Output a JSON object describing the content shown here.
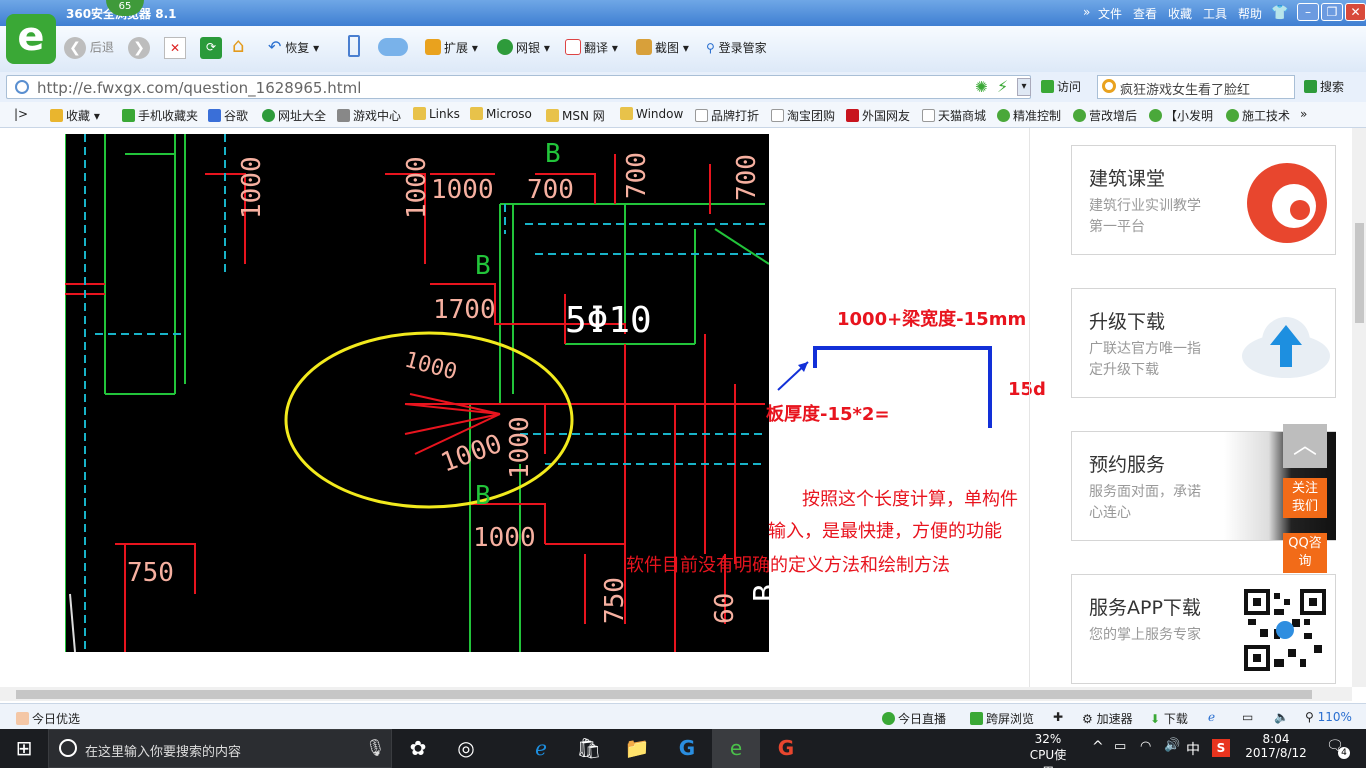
{
  "window": {
    "title": "360安全浏览器 8.1",
    "badge": "65",
    "menu": [
      "文件",
      "查看",
      "收藏",
      "工具",
      "帮助"
    ],
    "min": "–",
    "max": "❐",
    "close": "✕"
  },
  "toolbar": {
    "back": "后退",
    "restore": "恢复",
    "extend": "扩展",
    "netbank": "网银",
    "translate": "翻译",
    "screenshot": "截图",
    "login": "登录管家"
  },
  "address": {
    "url": "http://e.fwxgx.com/question_1628965.html",
    "visit": "访问",
    "search_value": "疯狂游戏女生看了脸红",
    "search_button": "搜索"
  },
  "bookmarks": [
    "收藏",
    "手机收藏夹",
    "谷歌",
    "网址大全",
    "游戏中心",
    "Links",
    "Microso",
    "MSN 网",
    "Window",
    "品牌打折",
    "淘宝团购",
    "外国网友",
    "天猫商城",
    "精准控制",
    "营改增后",
    "【小发明",
    "施工技术"
  ],
  "cad": {
    "labels": [
      "1000",
      "1000",
      "700",
      "700",
      "700",
      "1000",
      "1700",
      "5Φ10",
      "1000",
      "1000",
      "1000",
      "1000",
      "750",
      "750",
      "60",
      "B",
      "B",
      "B",
      "B"
    ]
  },
  "annotation": {
    "top_label": "1000+梁宽度-15mm",
    "side_label": "15d",
    "left_label": "板厚度-15*2=",
    "note_line1": "按照这个长度计算，单构件",
    "note_line2": "输入，是最快捷，方便的功能",
    "note_line3": "软件目前没有明确的定义方法和绘制方法"
  },
  "sidebar": {
    "cards": [
      {
        "title": "建筑课堂",
        "sub": "建筑行业实训教学第一平台"
      },
      {
        "title": "升级下载",
        "sub": "广联达官方唯一指定升级下载"
      },
      {
        "title": "预约服务",
        "sub": "服务面对面，承诺心连心"
      },
      {
        "title": "服务APP下载",
        "sub": "您的掌上服务专家"
      }
    ],
    "follow": "关注我们",
    "qq": "QQ咨询"
  },
  "status": {
    "left": "今日优选",
    "live": "今日直播",
    "cross": "跨屏浏览",
    "accel": "加速器",
    "download": "下载",
    "zoom": "110%"
  },
  "taskbar": {
    "search_placeholder": "在这里输入你要搜索的内容",
    "cpu_percent": "32%",
    "cpu_label": "CPU使用",
    "ime": "中",
    "time": "8:04",
    "date": "2017/8/12",
    "notif": "4"
  },
  "colors": {
    "accent": "#3f7fd2",
    "annotation_red": "#e8141e",
    "annotation_blue": "#1230d8",
    "cad_yellow": "#f2ea1d"
  }
}
